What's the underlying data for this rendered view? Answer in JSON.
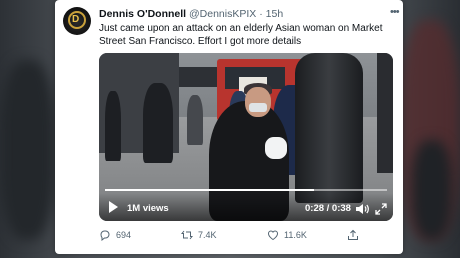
{
  "tweet": {
    "author_name": "Dennis O'Donnell",
    "author_handle": "@DennisKPIX",
    "separator": "·",
    "timestamp": "15h",
    "text": "Just came upon an attack on an elderly Asian woman on Market Street San Francisco.  Effort I got more details"
  },
  "video": {
    "views": "1M views",
    "timecode": "0:28 / 0:38",
    "progress_fraction": 0.74
  },
  "actions": {
    "reply_count": "694",
    "retweet_count": "7.4K",
    "like_count": "11.6K"
  },
  "icons": {
    "more": "more-icon",
    "play": "play-icon",
    "volume": "volume-icon",
    "expand": "expand-icon",
    "reply": "reply-icon",
    "retweet": "retweet-icon",
    "like": "heart-icon",
    "share": "share-icon"
  },
  "colors": {
    "text_primary": "#0f1419",
    "text_secondary": "#536471",
    "card_bg": "#ffffff"
  }
}
